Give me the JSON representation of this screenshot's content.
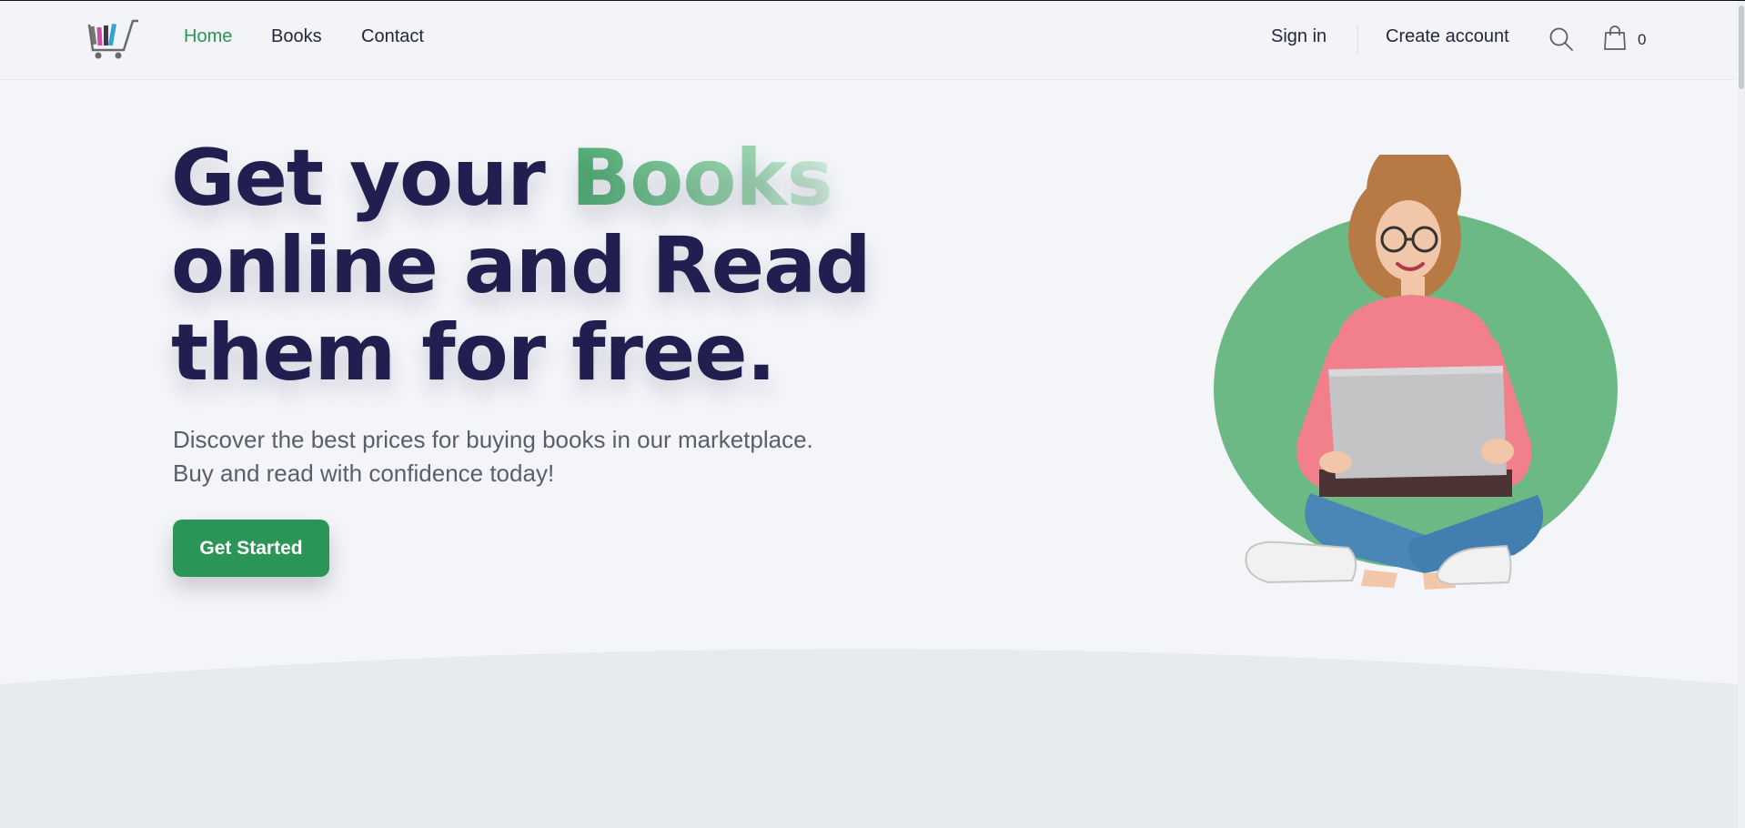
{
  "nav": {
    "logo_alt": "bookstore cart logo",
    "links": [
      {
        "label": "Home",
        "active": true
      },
      {
        "label": "Books",
        "active": false
      },
      {
        "label": "Contact",
        "active": false
      }
    ],
    "sign_in": "Sign in",
    "create_account": "Create account",
    "search_icon": "search-icon",
    "cart_icon": "shopping-bag-icon",
    "cart_count": "0"
  },
  "hero": {
    "title_part1": "Get your ",
    "title_accent": "Books",
    "title_line2": "online and Read",
    "title_line3": "them for free.",
    "subtitle_line1": "Discover the best prices for buying books in our marketplace.",
    "subtitle_line2": "Buy and read with confidence today!",
    "cta_label": "Get Started",
    "illustration": "woman-with-laptop-illustration"
  },
  "colors": {
    "accent_green": "#2a9556",
    "title_navy": "#221e4f",
    "circle_green": "#6cb985",
    "background": "#f3f5f9"
  }
}
